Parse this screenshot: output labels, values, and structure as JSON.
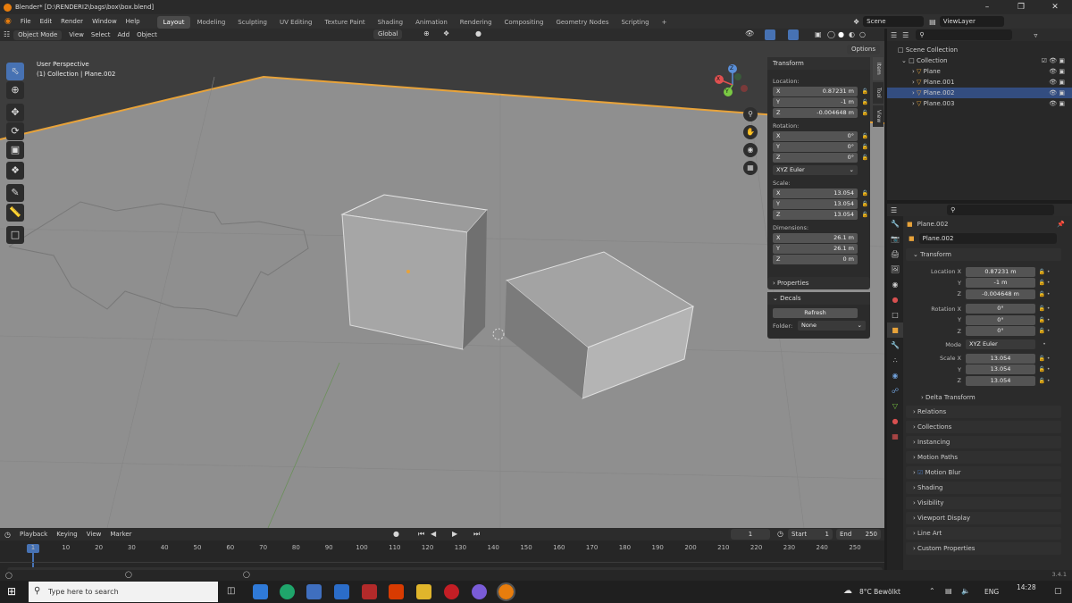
{
  "titlebar": {
    "title": "Blender* [D:\\RENDERI2\\bags\\box\\box.blend]"
  },
  "menu": {
    "items": [
      "File",
      "Edit",
      "Render",
      "Window",
      "Help"
    ],
    "workspaces": [
      "Layout",
      "Modeling",
      "Sculpting",
      "UV Editing",
      "Texture Paint",
      "Shading",
      "Animation",
      "Rendering",
      "Compositing",
      "Geometry Nodes",
      "Scripting"
    ],
    "add_tab": "+",
    "scene": "Scene",
    "view_layer": "ViewLayer"
  },
  "viewport_header": {
    "mode": "Object Mode",
    "menus": [
      "View",
      "Select",
      "Add",
      "Object"
    ],
    "orientation": "Global",
    "options": "Options"
  },
  "viewport": {
    "perspective": "User Perspective",
    "context": "(1) Collection | Plane.002",
    "accent": "#e8a33a",
    "gizmo": {
      "x": "X",
      "y": "Y",
      "z": "Z"
    }
  },
  "npanel": {
    "header": "Transform",
    "location_label": "Location:",
    "location": [
      {
        "axis": "X",
        "value": "0.87231 m"
      },
      {
        "axis": "Y",
        "value": "-1 m"
      },
      {
        "axis": "Z",
        "value": "-0.004648 m"
      }
    ],
    "rotation_label": "Rotation:",
    "rotation": [
      {
        "axis": "X",
        "value": "0°"
      },
      {
        "axis": "Y",
        "value": "0°"
      },
      {
        "axis": "Z",
        "value": "0°"
      }
    ],
    "rotation_mode": "XYZ Euler",
    "scale_label": "Scale:",
    "scale": [
      {
        "axis": "X",
        "value": "13.054"
      },
      {
        "axis": "Y",
        "value": "13.054"
      },
      {
        "axis": "Z",
        "value": "13.054"
      }
    ],
    "dimensions_label": "Dimensions:",
    "dimensions": [
      {
        "axis": "X",
        "value": "26.1 m"
      },
      {
        "axis": "Y",
        "value": "26.1 m"
      },
      {
        "axis": "Z",
        "value": "0 m"
      }
    ],
    "properties": "Properties",
    "decals": "Decals",
    "refresh": "Refresh",
    "folder_label": "Folder:",
    "folder_value": "None",
    "tabs": [
      "Item",
      "Tool",
      "View"
    ]
  },
  "outliner": {
    "scene_collection": "Scene Collection",
    "collection": "Collection",
    "objects": [
      "Plane",
      "Plane.001",
      "Plane.002",
      "Plane.003"
    ],
    "selected": "Plane.002"
  },
  "properties": {
    "object_name": "Plane.002",
    "data_name": "Plane.002",
    "transform": "Transform",
    "location": [
      {
        "label": "Location X",
        "value": "0.87231 m"
      },
      {
        "label": "Y",
        "value": "-1 m"
      },
      {
        "label": "Z",
        "value": "-0.004648 m"
      }
    ],
    "rotation": [
      {
        "label": "Rotation X",
        "value": "0°"
      },
      {
        "label": "Y",
        "value": "0°"
      },
      {
        "label": "Z",
        "value": "0°"
      }
    ],
    "mode_label": "Mode",
    "mode_value": "XYZ Euler",
    "scale": [
      {
        "label": "Scale X",
        "value": "13.054"
      },
      {
        "label": "Y",
        "value": "13.054"
      },
      {
        "label": "Z",
        "value": "13.054"
      }
    ],
    "delta_transform": "Delta Transform",
    "sections": [
      "Relations",
      "Collections",
      "Instancing",
      "Motion Paths",
      "Motion Blur",
      "Shading",
      "Visibility",
      "Viewport Display",
      "Line Art",
      "Custom Properties"
    ]
  },
  "timeline": {
    "menus": [
      "Playback",
      "Keying",
      "View",
      "Marker"
    ],
    "current_frame": "1",
    "start_label": "Start",
    "start": "1",
    "end_label": "End",
    "end": "250",
    "frames": [
      "1",
      "10",
      "20",
      "30",
      "40",
      "50",
      "60",
      "70",
      "80",
      "90",
      "100",
      "110",
      "120",
      "130",
      "140",
      "150",
      "160",
      "170",
      "180",
      "190",
      "200",
      "210",
      "220",
      "230",
      "240",
      "250"
    ]
  },
  "statusbar": {
    "version": "3.4.1"
  },
  "taskbar": {
    "search_placeholder": "Type here to search",
    "weather": "8°C  Bewölkt",
    "lang": "ENG",
    "time": "14:28"
  }
}
